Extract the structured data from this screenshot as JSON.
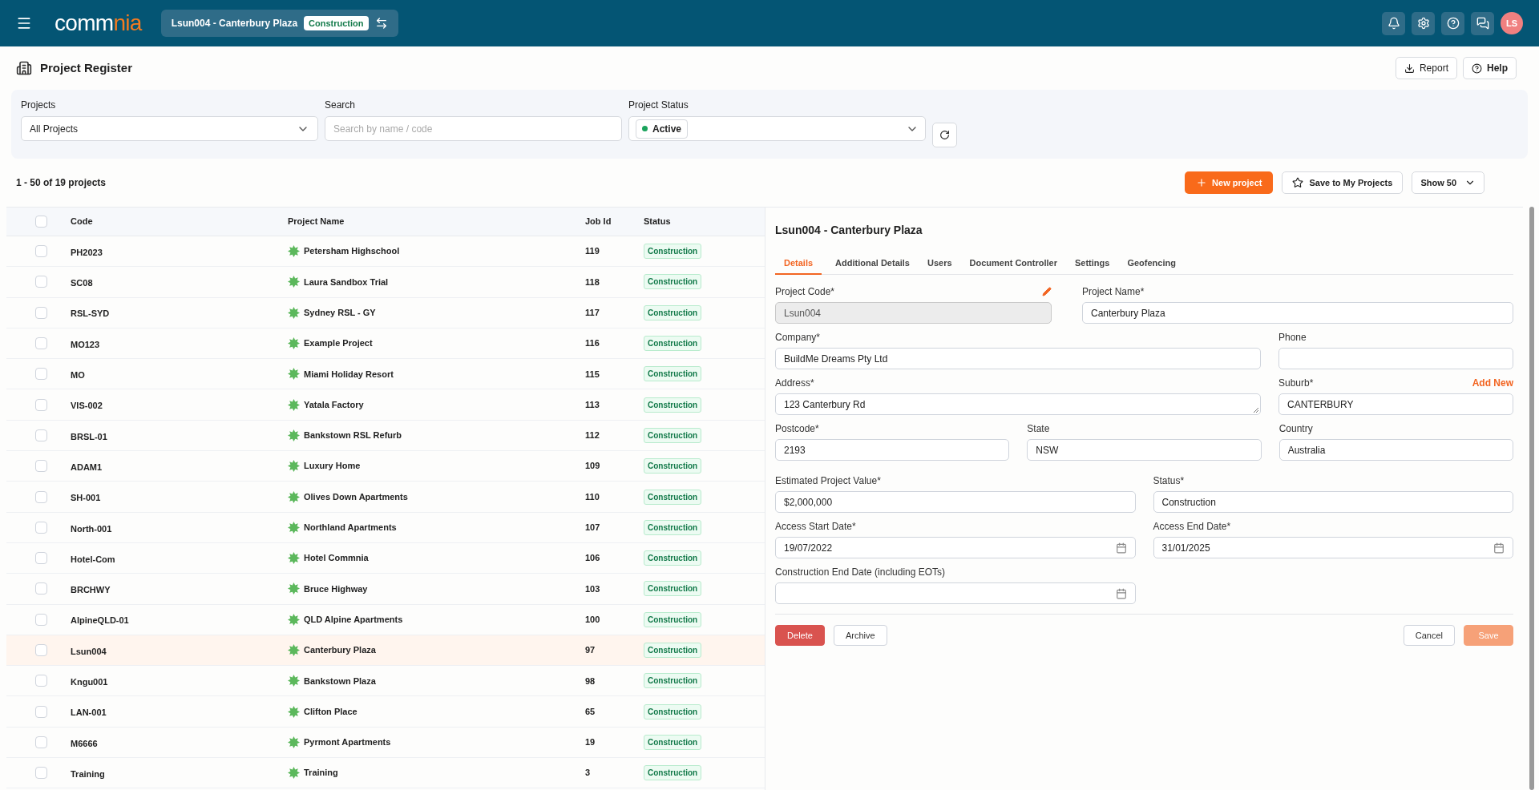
{
  "header": {
    "logo": {
      "left": "comm",
      "right": "nia"
    },
    "project_selector": {
      "name": "Lsun004 - Canterbury Plaza",
      "status": "Construction"
    },
    "avatar": "LS"
  },
  "page": {
    "title": "Project Register",
    "actions": [
      "Report",
      "Help"
    ]
  },
  "filters": {
    "projects": {
      "label": "Projects",
      "value": "All Projects"
    },
    "search": {
      "label": "Search",
      "placeholder": "Search by name / code"
    },
    "status": {
      "label": "Project Status",
      "value": "Active"
    }
  },
  "list": {
    "count": "1 - 50 of 19 projects",
    "new_project": "New project",
    "save": "Save to My Projects",
    "show": "Show 50"
  },
  "table": {
    "all_checked": false,
    "columns": [
      "Code",
      "Project Name",
      "Job Id",
      "Status"
    ],
    "rows": [
      {
        "code": "PH2023",
        "name": "Petersham Highschool",
        "job_id": "119",
        "status": "Construction",
        "selected": false,
        "checked": false
      },
      {
        "code": "SC08",
        "name": "Laura Sandbox Trial",
        "job_id": "118",
        "status": "Construction",
        "selected": false,
        "checked": false
      },
      {
        "code": "RSL-SYD",
        "name": "Sydney RSL - GY",
        "job_id": "117",
        "status": "Construction",
        "selected": false,
        "checked": false
      },
      {
        "code": "MO123",
        "name": "Example Project",
        "job_id": "116",
        "status": "Construction",
        "selected": false,
        "checked": false
      },
      {
        "code": "MO",
        "name": "Miami Holiday Resort",
        "job_id": "115",
        "status": "Construction",
        "selected": false,
        "checked": false
      },
      {
        "code": "VIS-002",
        "name": "Yatala Factory",
        "job_id": "113",
        "status": "Construction",
        "selected": false,
        "checked": false
      },
      {
        "code": "BRSL-01",
        "name": "Bankstown RSL Refurb",
        "job_id": "112",
        "status": "Construction",
        "selected": false,
        "checked": false
      },
      {
        "code": "ADAM1",
        "name": "Luxury Home",
        "job_id": "109",
        "status": "Construction",
        "selected": false,
        "checked": false
      },
      {
        "code": "SH-001",
        "name": "Olives Down Apartments",
        "job_id": "110",
        "status": "Construction",
        "selected": false,
        "checked": false
      },
      {
        "code": "North-001",
        "name": "Northland Apartments",
        "job_id": "107",
        "status": "Construction",
        "selected": false,
        "checked": false
      },
      {
        "code": "Hotel-Com",
        "name": "Hotel Commnia",
        "job_id": "106",
        "status": "Construction",
        "selected": false,
        "checked": false
      },
      {
        "code": "BRCHWY",
        "name": "Bruce Highway",
        "job_id": "103",
        "status": "Construction",
        "selected": false,
        "checked": false
      },
      {
        "code": "AlpineQLD-01",
        "name": "QLD Alpine Apartments",
        "job_id": "100",
        "status": "Construction",
        "selected": false,
        "checked": false
      },
      {
        "code": "Lsun004",
        "name": "Canterbury Plaza",
        "job_id": "97",
        "status": "Construction",
        "selected": true,
        "checked": false
      },
      {
        "code": "Kngu001",
        "name": "Bankstown Plaza",
        "job_id": "98",
        "status": "Construction",
        "selected": false,
        "checked": false
      },
      {
        "code": "LAN-001",
        "name": "Clifton Place",
        "job_id": "65",
        "status": "Construction",
        "selected": false,
        "checked": false
      },
      {
        "code": "M6666",
        "name": "Pyrmont Apartments",
        "job_id": "19",
        "status": "Construction",
        "selected": false,
        "checked": false
      },
      {
        "code": "Training",
        "name": "Training",
        "job_id": "3",
        "status": "Construction",
        "selected": false,
        "checked": false
      }
    ]
  },
  "detail": {
    "title": "Lsun004 - Canterbury Plaza",
    "tabs": [
      {
        "label": "Details",
        "selected": true
      },
      {
        "label": "Additional Details",
        "selected": false
      },
      {
        "label": "Users",
        "selected": false
      },
      {
        "label": "Document Controller",
        "selected": false
      },
      {
        "label": "Settings",
        "selected": false
      },
      {
        "label": "Geofencing",
        "selected": false
      }
    ],
    "field_rows": [
      [
        {
          "label": "Project Code*",
          "value": "Lsun004",
          "kind": "locked"
        },
        {
          "label": "Project Name*",
          "value": "Canterbury Plaza",
          "kind": "text"
        }
      ],
      [
        {
          "label": "Company*",
          "value": "BuildMe Dreams Pty Ltd",
          "kind": "text"
        },
        {
          "label": "Phone",
          "kind": "text"
        }
      ],
      [
        {
          "label": "Address*",
          "value": "123 Canterbury Rd",
          "kind": "textarea"
        },
        {
          "label": "Suburb*",
          "value": "CANTERBURY",
          "kind": "text",
          "link": "Add New"
        }
      ],
      [
        {
          "label": "Postcode*",
          "value": "2193",
          "kind": "text"
        },
        {
          "label": "State",
          "value": "NSW",
          "kind": "text"
        },
        {
          "label": "Country",
          "value": "Australia",
          "kind": "text"
        }
      ],
      [
        {
          "label": "Estimated Project Value*",
          "value": "$2,000,000",
          "kind": "text"
        },
        {
          "label": "Status*",
          "value": "Construction",
          "kind": "text"
        }
      ],
      [
        {
          "label": "Access Start Date*",
          "value": "19/07/2022",
          "kind": "date"
        },
        {
          "label": "Access End Date*",
          "value": "31/01/2025",
          "kind": "date"
        }
      ],
      [
        {
          "label": "Construction End Date (including EOTs)",
          "kind": "date"
        }
      ]
    ],
    "buttons": [
      {
        "label": "Delete",
        "kind": "danger",
        "disabled": false
      },
      {
        "label": "Archive",
        "kind": "outline",
        "disabled": false
      },
      {
        "label": "Cancel",
        "kind": "outline",
        "disabled": false
      },
      {
        "label": "Save",
        "kind": "primary",
        "disabled": true
      }
    ]
  }
}
